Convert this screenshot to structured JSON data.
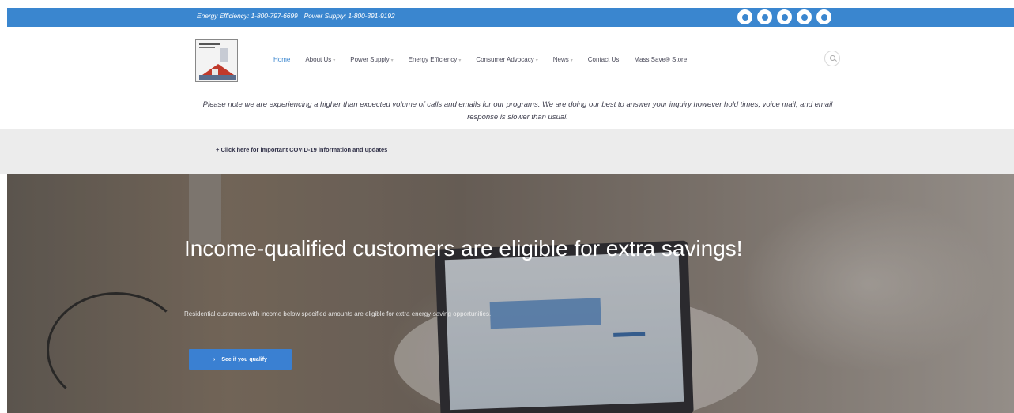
{
  "topbar": {
    "energy_efficiency": "Energy Efficiency: 1-800-797-6699",
    "power_supply": "Power Supply: 1-800-391-9192",
    "social_icons": [
      "facebook-icon",
      "instagram-icon",
      "twitter-icon",
      "email-icon",
      "linkedin-icon"
    ]
  },
  "nav": {
    "items": [
      {
        "label": "Home",
        "has_dropdown": false
      },
      {
        "label": "About Us",
        "has_dropdown": true
      },
      {
        "label": "Power Supply",
        "has_dropdown": true
      },
      {
        "label": "Energy Efficiency",
        "has_dropdown": true
      },
      {
        "label": "Consumer Advocacy",
        "has_dropdown": true
      },
      {
        "label": "News",
        "has_dropdown": true
      },
      {
        "label": "Contact Us",
        "has_dropdown": false
      },
      {
        "label": "Mass Save® Store",
        "has_dropdown": false
      }
    ],
    "caret": "▾"
  },
  "notice": {
    "text": "Please note we are experiencing a higher than expected volume of calls and emails for our programs. We are doing our best to answer your inquiry however hold times, voice mail, and email response is slower than usual."
  },
  "covid": {
    "link": "+ Click here for important COVID-19 information and updates"
  },
  "hero": {
    "title": "Income-qualified customers are eligible for extra savings!",
    "subtitle": "Residential customers with income below specified amounts are eligible for extra energy-saving opportunities.",
    "button_label": "See if you qualify",
    "button_arrow": "›"
  },
  "colors": {
    "brand_blue": "#3a86cf",
    "button_blue": "#3a80d2"
  }
}
